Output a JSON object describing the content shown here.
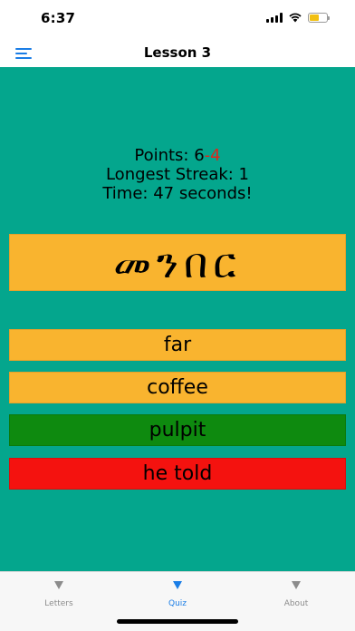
{
  "status": {
    "time": "6:37",
    "battery_color": "#f2c012"
  },
  "nav": {
    "title": "Lesson 3",
    "menu_icon": "hamburger-menu-icon"
  },
  "stats": {
    "points_label": "Points: ",
    "points_value": "6",
    "points_penalty": "-4",
    "longest_streak": "Longest Streak: 1",
    "time": "Time: 47 seconds!"
  },
  "question": {
    "word": "መንበር"
  },
  "answers": [
    {
      "label": "far",
      "state": "neutral"
    },
    {
      "label": "coffee",
      "state": "neutral"
    },
    {
      "label": "pulpit",
      "state": "correct"
    },
    {
      "label": "he told",
      "state": "wrong"
    }
  ],
  "tabs": [
    {
      "label": "Letters",
      "icon": "triangle-down-icon",
      "active": false
    },
    {
      "label": "Quiz",
      "icon": "triangle-down-icon",
      "active": true
    },
    {
      "label": "About",
      "icon": "triangle-down-icon",
      "active": false
    }
  ],
  "colors": {
    "background": "#04a68d",
    "card": "#f9b42f",
    "correct": "#0e8a0f",
    "wrong": "#f4120f",
    "accent": "#1a7de6",
    "penalty": "#e1251b"
  }
}
